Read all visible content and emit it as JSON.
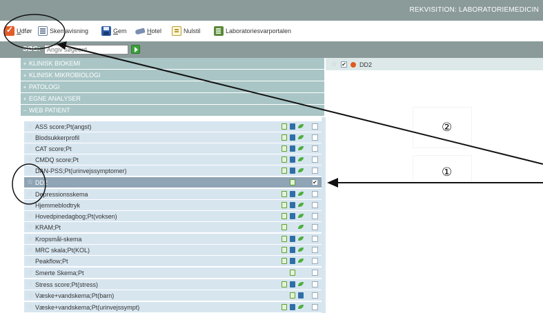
{
  "window": {
    "title": "REKVISITION: LABORATORIEMEDICIN"
  },
  "toolbar": {
    "buttons": [
      {
        "label": "Udfør",
        "icon": "execute-check-icon"
      },
      {
        "label": "Skemavisning",
        "icon": "schema-view-icon"
      },
      {
        "label": "Gem",
        "icon": "save-floppy-icon"
      },
      {
        "label": "Hotel",
        "icon": "hotel-icon"
      },
      {
        "label": "Nulstil",
        "icon": "reset-icon"
      },
      {
        "label": "Laboratoriesvarportalen",
        "icon": "lab-portal-icon"
      }
    ]
  },
  "search": {
    "label": "SØG:",
    "placeholder": "Angiv søgeord"
  },
  "categories": [
    {
      "toggle": "+",
      "label": "KLINISK BIOKEMI"
    },
    {
      "toggle": "+",
      "label": "KLINISK MIKROBIOLOGI"
    },
    {
      "toggle": "+",
      "label": "PATOLOGI"
    },
    {
      "toggle": "+",
      "label": "EGNE ANALYSER"
    },
    {
      "toggle": "−",
      "label": "WEB PATIENT"
    }
  ],
  "web_patient_items": [
    {
      "label": "ASS score;Pt(angst)",
      "checked": ""
    },
    {
      "label": "Blodsukkerprofil",
      "checked": ""
    },
    {
      "label": "CAT score;Pt",
      "checked": ""
    },
    {
      "label": "CMDQ score;Pt",
      "checked": ""
    },
    {
      "label": "DAN-PSS;Pt(urinvejssymptomer)",
      "checked": ""
    },
    {
      "label": "DD2",
      "checked": "✔"
    },
    {
      "label": "Depressionsskema",
      "checked": ""
    },
    {
      "label": "Hjemmeblodtryk",
      "checked": ""
    },
    {
      "label": "Hovedpinedagbog;Pt(voksen)",
      "checked": ""
    },
    {
      "label": "KRAM;Pt",
      "checked": ""
    },
    {
      "label": "Kropsmål-skema",
      "checked": ""
    },
    {
      "label": "MRC skala;Pt(KOL)",
      "checked": ""
    },
    {
      "label": "Peakflow;Pt",
      "checked": ""
    },
    {
      "label": "Smerte Skema;Pt",
      "checked": ""
    },
    {
      "label": "Stress score;Pt(stress)",
      "checked": ""
    },
    {
      "label": "Væske+vandskema;Pt(barn)",
      "checked": ""
    },
    {
      "label": "Væske+vandskema;Pt(urinvejssympt)",
      "checked": ""
    }
  ],
  "selected_panel": {
    "item_label": "DD2",
    "checked": "✔"
  },
  "annotations": {
    "marker_1": "①",
    "marker_2": "②"
  },
  "colors": {
    "header_gray": "#8a9b9a",
    "category_teal": "#a9c5c6",
    "item_blue": "#d7e5ef",
    "selected_row": "#8fa4b4",
    "status_dot": "#e05a1e"
  }
}
